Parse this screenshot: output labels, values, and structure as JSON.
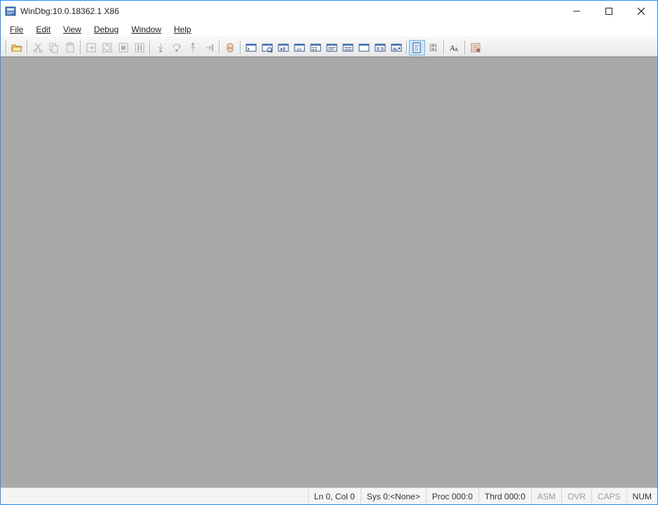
{
  "title": "WinDbg:10.0.18362.1 X86",
  "menu": {
    "file": "File",
    "edit": "Edit",
    "view": "View",
    "debug": "Debug",
    "window": "Window",
    "help": "Help"
  },
  "status": {
    "lncol": "Ln 0, Col 0",
    "sys": "Sys 0:<None>",
    "proc": "Proc 000:0",
    "thrd": "Thrd 000:0",
    "asm": "ASM",
    "ovr": "OVR",
    "caps": "CAPS",
    "num": "NUM"
  }
}
